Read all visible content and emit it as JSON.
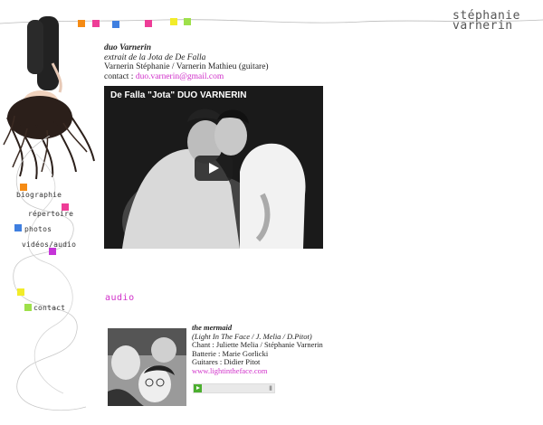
{
  "brand": {
    "line1": "stéphanie",
    "line2": "varnerin"
  },
  "nav": [
    {
      "label": "biographie"
    },
    {
      "label": "répertoire"
    },
    {
      "label": "photos"
    },
    {
      "label": "vidéos/audio"
    },
    {
      "label": "contact"
    }
  ],
  "colors": {
    "orange": "#f58b14",
    "pink": "#ee3d97",
    "blue": "#3f7fe0",
    "magenta": "#c534d8",
    "yellow": "#f2ec2a",
    "green": "#9ee04a",
    "accent": "#d02fc9"
  },
  "video_block": {
    "title": "duo Varnerin",
    "subtitle": "extrait de la Jota de De Falla",
    "members": "Varnerin Stéphanie / Varnerin Mathieu (guitare)",
    "contact_label": "contact :",
    "contact_email": "duo.varnerin@gmail.com",
    "video_title": "De Falla \"Jota\" DUO VARNERIN"
  },
  "audio": {
    "heading": "audio",
    "track": {
      "title": "the mermaid",
      "credits": "(Light In The Face / J. Melia / D.Pitot)",
      "chant": "Chant : Juliette Melia / Stéphanie Varnerin",
      "batterie": "Batterie : Marie Gorlicki",
      "guitares": "Guitares : Didier Pitot",
      "link": "www.lightintheface.com"
    }
  }
}
